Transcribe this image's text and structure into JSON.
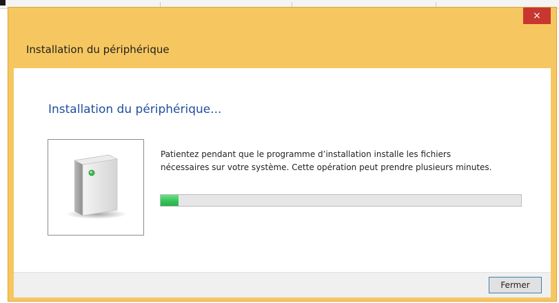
{
  "window": {
    "title": "Installation du périphérique",
    "close_symbol": "×",
    "close_icon": "close-icon"
  },
  "content": {
    "heading": "Installation du périphérique...",
    "device_icon": "device-icon",
    "message_line1": "Patientez pendant que le programme d’installation installe les fichiers",
    "message_line2": "nécessaires sur votre système. Cette opération peut prendre plusieurs minutes.",
    "progress_percent": 5
  },
  "footer": {
    "close_label": "Fermer"
  },
  "colors": {
    "title_bar": "#f6c760",
    "close_button": "#c7372f",
    "heading": "#1f4e9c",
    "progress": "#37c35a"
  }
}
